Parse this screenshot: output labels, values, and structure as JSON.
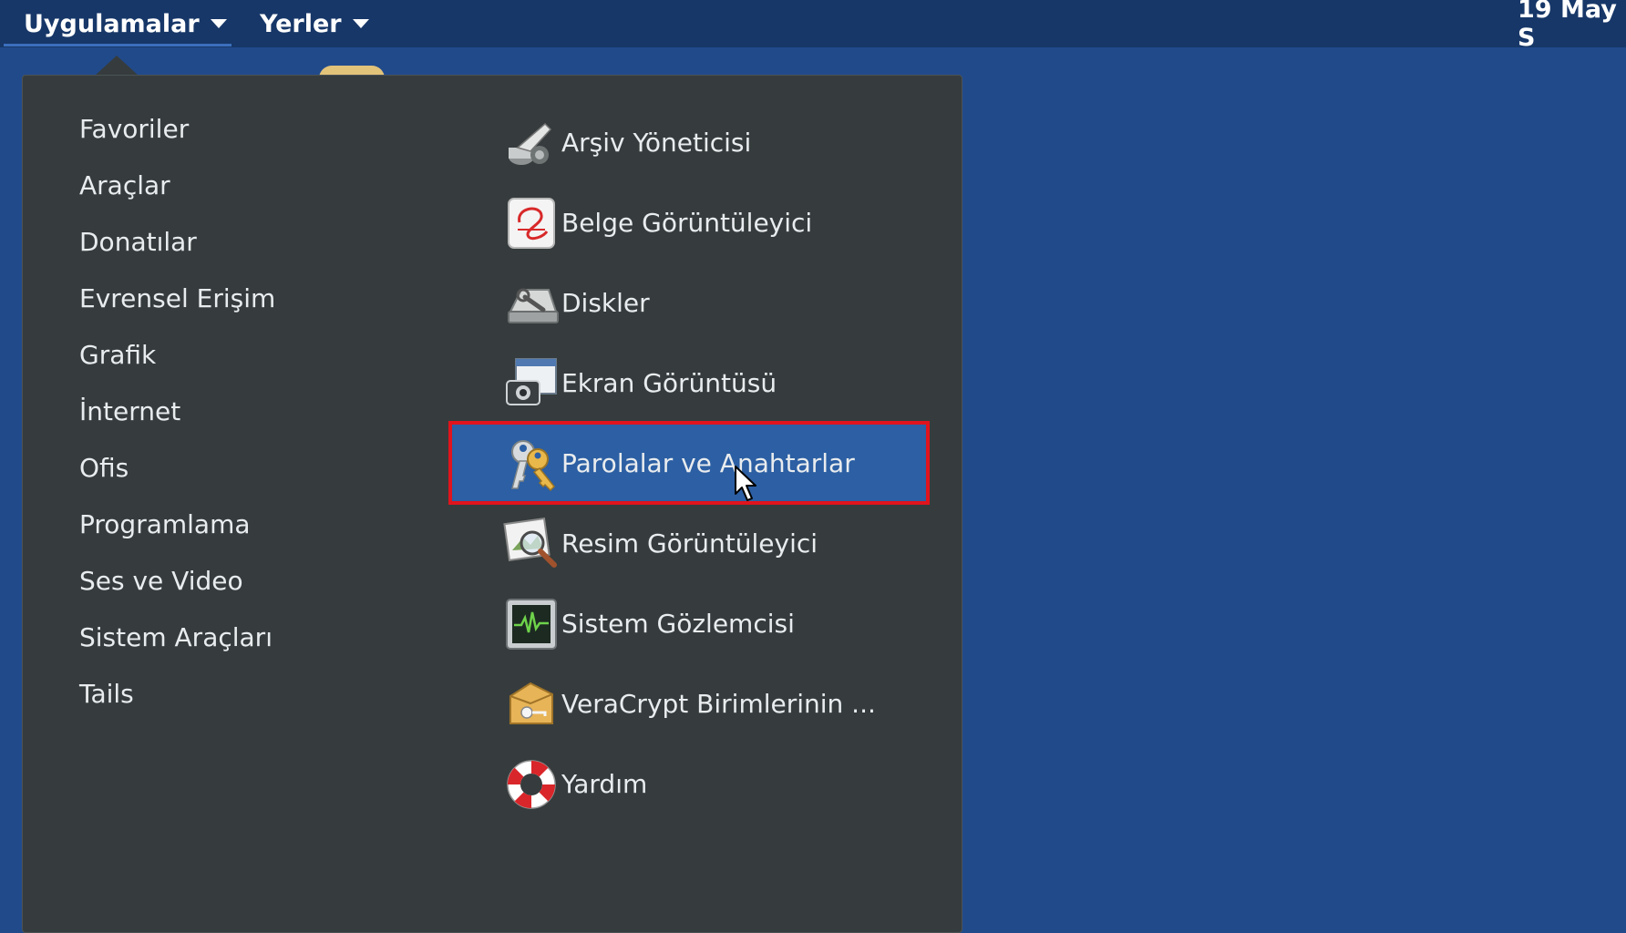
{
  "topbar": {
    "applications_label": "Uygulamalar",
    "places_label": "Yerler",
    "clock": "19 May S"
  },
  "menu": {
    "categories": [
      {
        "label": "Favoriler"
      },
      {
        "label": "Araçlar"
      },
      {
        "label": "Donatılar"
      },
      {
        "label": "Evrensel Erişim"
      },
      {
        "label": "Grafik"
      },
      {
        "label": "İnternet"
      },
      {
        "label": "Ofis"
      },
      {
        "label": "Programlama"
      },
      {
        "label": "Ses ve Video"
      },
      {
        "label": "Sistem Araçları"
      },
      {
        "label": "Tails"
      }
    ],
    "apps": [
      {
        "label": "Arşiv Yöneticisi",
        "icon": "archive-manager-icon"
      },
      {
        "label": "Belge Görüntüleyici",
        "icon": "document-viewer-icon"
      },
      {
        "label": "Diskler",
        "icon": "disks-icon"
      },
      {
        "label": "Ekran Görüntüsü",
        "icon": "screenshot-icon"
      },
      {
        "label": "Parolalar ve Anahtarlar",
        "icon": "keys-icon"
      },
      {
        "label": "Resim Görüntüleyici",
        "icon": "image-viewer-icon"
      },
      {
        "label": "Sistem Gözlemcisi",
        "icon": "system-monitor-icon"
      },
      {
        "label": "VeraCrypt Birimlerinin ...",
        "icon": "veracrypt-icon"
      },
      {
        "label": "Yardım",
        "icon": "help-lifebuoy-icon"
      }
    ],
    "selected_app_index": 4
  },
  "colors": {
    "desktop": "#214a8b",
    "topbar": "#173768",
    "menu_background": "#363c3d",
    "selection": "#2c5fa3",
    "highlight_outline": "#e0141d"
  }
}
